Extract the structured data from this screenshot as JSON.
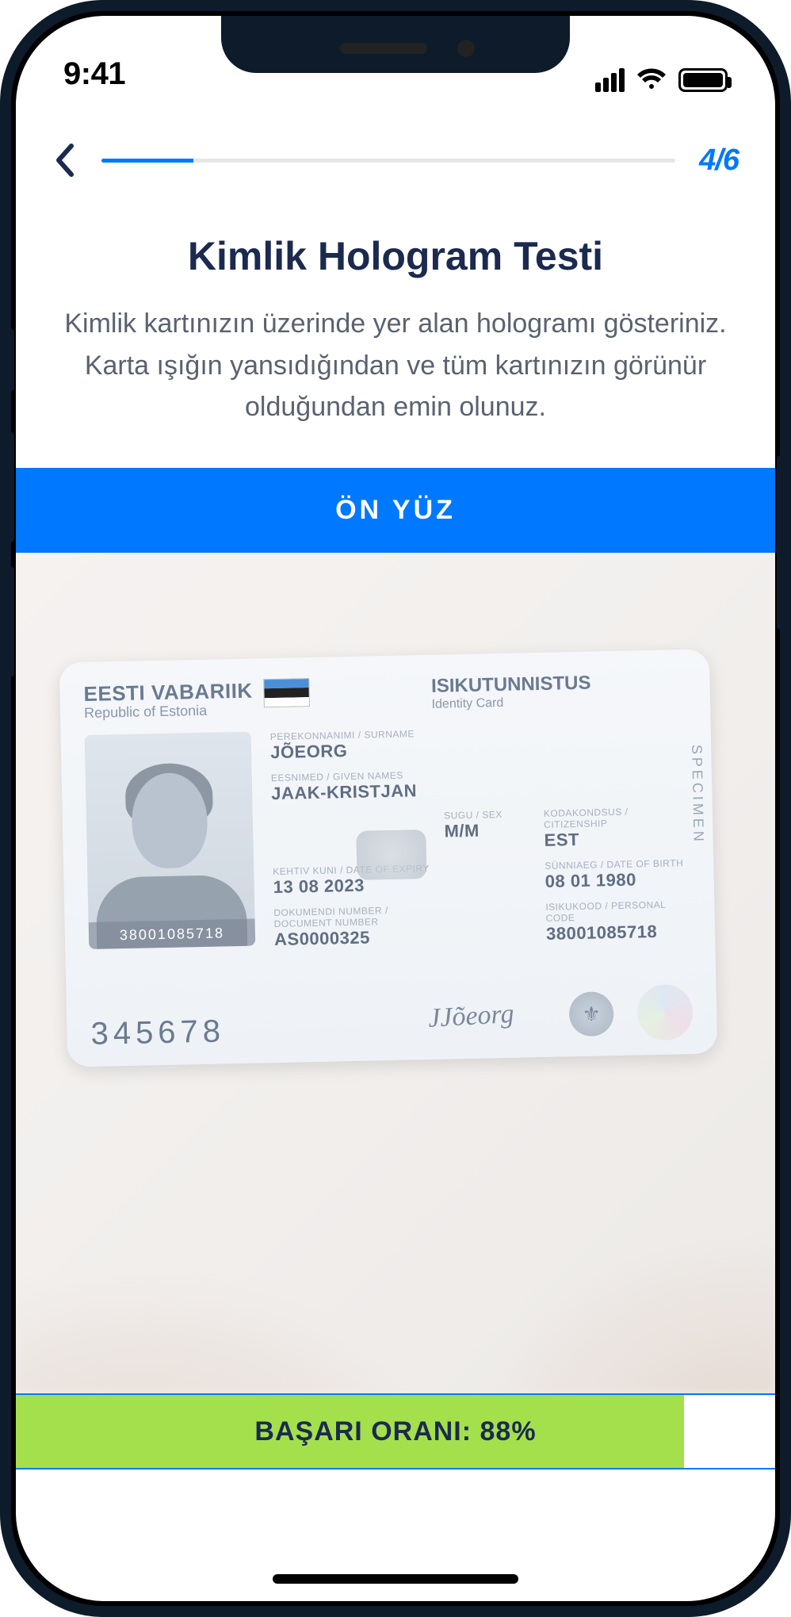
{
  "status": {
    "time": "9:41"
  },
  "nav": {
    "step_current": 4,
    "step_total": 6,
    "step_label": "4/6",
    "progress_percent": 16
  },
  "page": {
    "title": "Kimlik Hologram Testi",
    "description": "Kimlik kartınızın üzerinde yer alan hologramı gösteriniz. Karta ışığın yansıdığından ve tüm kartınızın görünür olduğundan emin olunuz.",
    "banner": "ÖN YÜZ"
  },
  "id_card": {
    "country_native": "EESTI VABARIIK",
    "country_en": "Republic of Estonia",
    "doc_type_native": "ISIKUTUNNISTUS",
    "doc_type_en": "Identity Card",
    "specimen": "SPECIMEN",
    "surname": "JÕEORG",
    "given_names": "JAAK-KRISTJAN",
    "sex": "M/M",
    "nationality": "EST",
    "birth_date": "08 01 1980",
    "expiry": "13 08 2023",
    "doc_number": "AS0000325",
    "personal_code": "38001085718",
    "photo_code": "38001085718",
    "serial": "345678",
    "signature": "JJõeorg"
  },
  "success": {
    "label": "BAŞARI ORANI: 88%",
    "percent": 88
  },
  "colors": {
    "primary": "#0078ff",
    "heading": "#1b2a4e",
    "success": "#a4e04c"
  }
}
